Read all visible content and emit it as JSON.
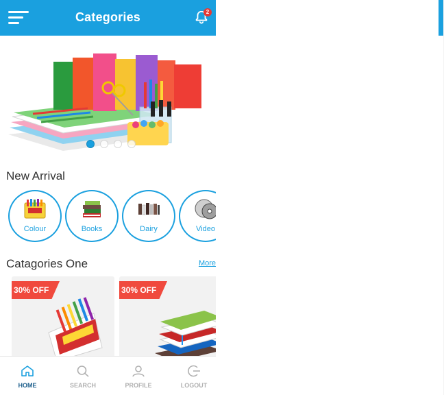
{
  "header": {
    "title": "Categories",
    "menu_icon": "hamburger-menu-icon",
    "notification_icon": "bell-icon",
    "notification_count": "2"
  },
  "banner": {
    "slides": 4,
    "active_slide": 1,
    "subject": "stationery-photo"
  },
  "new_arrival": {
    "title": "New Arrival",
    "items": [
      {
        "label": "Colour",
        "icon": "crayons-icon"
      },
      {
        "label": "Books",
        "icon": "books-icon"
      },
      {
        "label": "Dairy",
        "icon": "dairy-books-icon"
      },
      {
        "label": "Video",
        "icon": "disc-icon"
      }
    ]
  },
  "categories_one": {
    "title": "Catagories One",
    "more_label": "More",
    "products": [
      {
        "discount": "30% OFF",
        "image": "markers-box"
      },
      {
        "discount": "30% OFF",
        "image": "notebook-stack"
      }
    ]
  },
  "bottom_nav": [
    {
      "label": "HOME",
      "icon": "home-icon",
      "active": true
    },
    {
      "label": "SEARCH",
      "icon": "search-icon",
      "active": false
    },
    {
      "label": "PROFILE",
      "icon": "profile-icon",
      "active": false
    },
    {
      "label": "LOGOUT",
      "icon": "logout-icon",
      "active": false
    }
  ],
  "colors": {
    "primary": "#1aa0df",
    "badge": "#e53935",
    "ribbon": "#f04a3e",
    "nav_active": "#1d5f8c",
    "nav_inactive": "#b0b0b0"
  }
}
